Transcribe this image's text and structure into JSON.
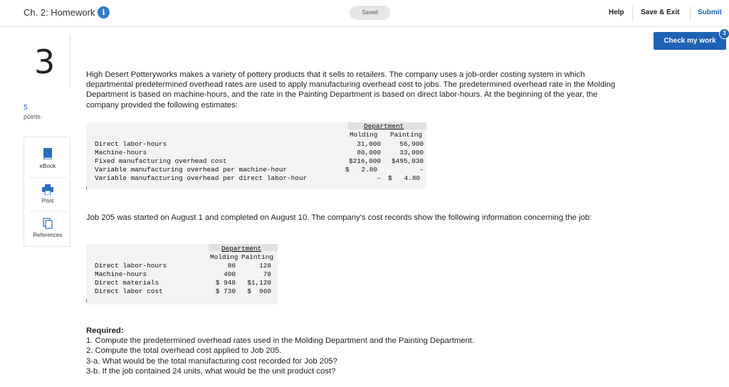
{
  "header": {
    "title": "Ch. 2: Homework",
    "info_icon": "i",
    "saved": "Saved",
    "help": "Help",
    "save_exit": "Save & Exit",
    "submit": "Submit",
    "check_work": "Check my work",
    "check_badge": "3"
  },
  "question": {
    "number": "3",
    "points_value": "5",
    "points_label": "points"
  },
  "tools": {
    "ebook": "eBook",
    "print": "Print",
    "references": "References"
  },
  "content": {
    "intro": "High Desert Potteryworks makes a variety of pottery products that it sells to retailers. The company uses a job-order costing system in which departmental predetermined overhead rates are used to apply manufacturing overhead cost to jobs. The predetermined overhead rate in the Molding Department is based on machine-hours, and the rate in the Painting Department is based on direct labor-hours. At the beginning of the year, the company provided the following estimates:",
    "job_text": "Job 205 was started on August 1 and completed on August 10. The company's cost records show the following information concerning the job:",
    "required_title": "Required:",
    "required_items": [
      "1. Compute the predetermined overhead rates used in the Molding Department and the Painting Department.",
      "2. Compute the total overhead cost applied to Job 205.",
      "3-a. What would be the total manufacturing cost recorded for Job 205?",
      "3-b. If the job contained 24 units, what would be the unit product cost?"
    ]
  },
  "table1": {
    "group_header": "Department",
    "col1": "Molding",
    "col2": "Painting",
    "rows": [
      {
        "label": "Direct labor-hours",
        "c1": "31,000",
        "c2": "56,900"
      },
      {
        "label": "Machine-hours",
        "c1": "80,000",
        "c2": "33,000"
      },
      {
        "label": "Fixed manufacturing overhead cost",
        "c1": "$216,000",
        "c2": "$495,030"
      },
      {
        "label": "Variable manufacturing overhead per machine-hour",
        "c1": "$   2.80",
        "c2": "–"
      },
      {
        "label": "Variable manufacturing overhead per direct labor-hour",
        "c1": "–",
        "c2": "$   4.80"
      }
    ]
  },
  "table2": {
    "group_header": "Department",
    "col1": "Molding",
    "col2": "Painting",
    "rows": [
      {
        "label": "Direct labor-hours",
        "c1": "86",
        "c2": "128"
      },
      {
        "label": "Machine-hours",
        "c1": "400",
        "c2": "70"
      },
      {
        "label": "Direct materials",
        "c1": "$ 948",
        "c2": "$1,120"
      },
      {
        "label": "Direct labor cost",
        "c1": "$ 730",
        "c2": "$  960"
      }
    ]
  }
}
